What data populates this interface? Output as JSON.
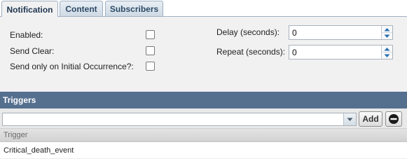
{
  "tabs": [
    {
      "label": "Notification",
      "active": true
    },
    {
      "label": "Content",
      "active": false
    },
    {
      "label": "Subscribers",
      "active": false
    }
  ],
  "settings": {
    "enabled_label": "Enabled:",
    "enabled_checked": false,
    "send_clear_label": "Send Clear:",
    "send_clear_checked": false,
    "initial_only_label": "Send only on Initial Occurrence?:",
    "initial_only_checked": false,
    "delay_label": "Delay (seconds):",
    "delay_value": "0",
    "repeat_label": "Repeat (seconds):",
    "repeat_value": "0"
  },
  "triggers": {
    "title": "Triggers",
    "combo_value": "",
    "add_label": "Add",
    "column_header": "Trigger",
    "rows": [
      "Critical_death_event"
    ]
  },
  "icons": {
    "spin_up": "arrow-up-icon",
    "spin_down": "arrow-down-icon",
    "combo": "chevron-down-icon",
    "remove": "minus-circle-icon"
  },
  "colors": {
    "section_header": "#556f8f",
    "panel_bg": "#f1f1f1",
    "tab_text": "#2d4a66"
  }
}
